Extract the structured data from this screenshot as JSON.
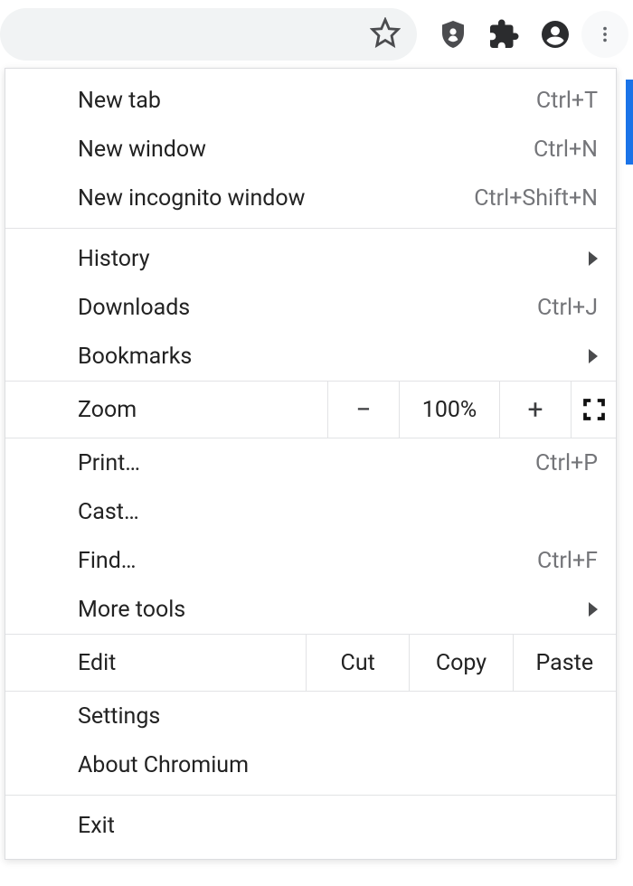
{
  "menu": {
    "new_tab": {
      "label": "New tab",
      "shortcut": "Ctrl+T"
    },
    "new_window": {
      "label": "New window",
      "shortcut": "Ctrl+N"
    },
    "new_incognito": {
      "label": "New incognito window",
      "shortcut": "Ctrl+Shift+N"
    },
    "history": {
      "label": "History"
    },
    "downloads": {
      "label": "Downloads",
      "shortcut": "Ctrl+J"
    },
    "bookmarks": {
      "label": "Bookmarks"
    },
    "zoom": {
      "label": "Zoom",
      "value": "100%"
    },
    "print": {
      "label": "Print…",
      "shortcut": "Ctrl+P"
    },
    "cast": {
      "label": "Cast…"
    },
    "find": {
      "label": "Find…",
      "shortcut": "Ctrl+F"
    },
    "more_tools": {
      "label": "More tools"
    },
    "edit": {
      "label": "Edit",
      "cut": "Cut",
      "copy": "Copy",
      "paste": "Paste"
    },
    "settings": {
      "label": "Settings"
    },
    "about": {
      "label": "About Chromium"
    },
    "exit": {
      "label": "Exit"
    }
  }
}
